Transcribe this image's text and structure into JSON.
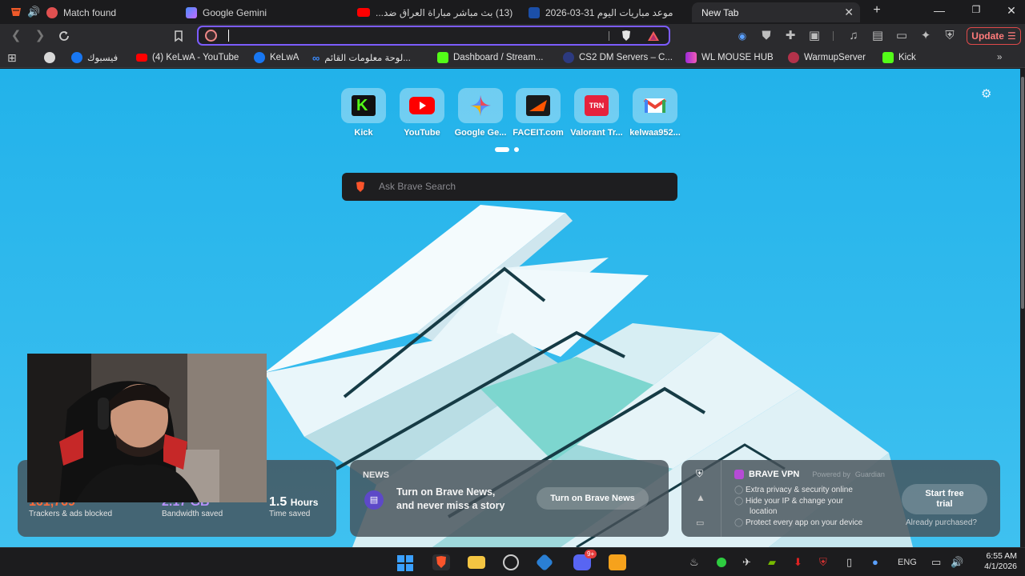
{
  "tabs": [
    {
      "title": "Match found",
      "fav_color": "#e05050"
    },
    {
      "title": "Google Gemini",
      "fav_color": "#6c8cff"
    },
    {
      "title": "(13) بث مباشر مباراة العراق ضد...",
      "fav_color": "#ff0000"
    },
    {
      "title": "موعد مباريات اليوم 31-03-2026",
      "fav_color": "#1b4fa8"
    },
    {
      "title": "New Tab",
      "fav_color": "#2b2b2e"
    }
  ],
  "toolbar": {
    "url_value": "",
    "update_label": "Update"
  },
  "bookmarks": [
    {
      "label": "",
      "icon": "steam-icon"
    },
    {
      "label": "فيسبوك",
      "icon": "facebook-icon"
    },
    {
      "label": "(4) KeLwA - YouTube",
      "icon": "youtube-icon"
    },
    {
      "label": "KeLwA",
      "icon": "facebook-icon"
    },
    {
      "label": "لوحة معلومات القائم...",
      "icon": "meta-icon"
    },
    {
      "label": "Dashboard / Stream...",
      "icon": "dashboard-icon"
    },
    {
      "label": "CS2 DM Servers – C...",
      "icon": "cs2-icon"
    },
    {
      "label": "WL MOUSE HUB",
      "icon": "wl-icon"
    },
    {
      "label": "WarmupServer",
      "icon": "warmup-icon"
    },
    {
      "label": "Kick",
      "icon": "kick-icon"
    }
  ],
  "top_sites": [
    {
      "name": "Kick"
    },
    {
      "name": "YouTube"
    },
    {
      "name": "Google Ge..."
    },
    {
      "name": "FACEIT.com"
    },
    {
      "name": "Valorant Tr..."
    },
    {
      "name": "kelwaa952..."
    }
  ],
  "search": {
    "placeholder": "Ask Brave Search"
  },
  "stats": {
    "trackers_value": "161,769",
    "trackers_label": "Trackers & ads blocked",
    "bandwidth_value": "2.17 GB",
    "bandwidth_label": "Bandwidth saved",
    "time_value": "1.5",
    "time_unit": "Hours",
    "time_label": "Time saved"
  },
  "news": {
    "heading": "NEWS",
    "line1": "Turn on Brave News,",
    "line2": "and never miss a story",
    "button": "Turn on Brave News"
  },
  "vpn": {
    "title": "BRAVE VPN",
    "powered": "Powered by",
    "guardian": "Guardian",
    "feature1": "Extra privacy & security online",
    "feature2a": "Hide your IP & change your",
    "feature2b": "location",
    "feature3": "Protect every app on your device",
    "trial_line1": "Start free",
    "trial_line2": "trial",
    "purchased": "Already purchased?"
  },
  "taskbar": {
    "lang": "ENG",
    "time": "6:55 AM",
    "date": "4/1/2026",
    "discord_badge": "9+"
  },
  "colors": {
    "accent": "#7c5cff",
    "sky": "#2bb3ea",
    "update": "#e04a4a"
  }
}
